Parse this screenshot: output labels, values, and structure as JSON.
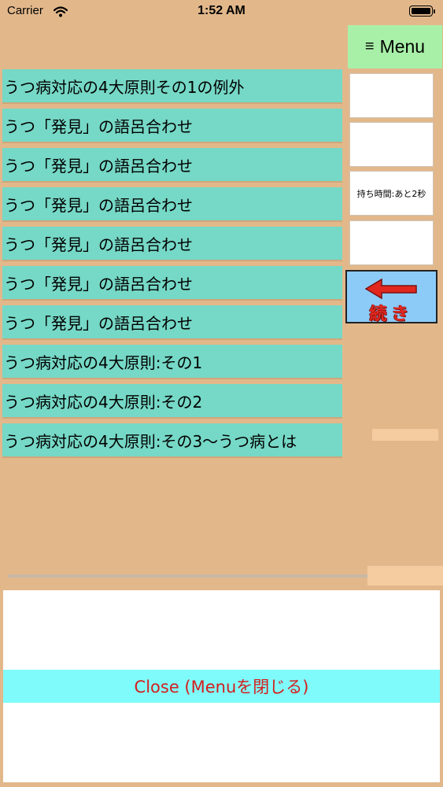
{
  "status_bar": {
    "carrier": "Carrier",
    "time": "1:52 AM",
    "icons": [
      "wifi-icon",
      "battery-icon"
    ]
  },
  "menu_button": {
    "icon": "hamburger-icon",
    "icon_glyph": "≡",
    "label": "Menu"
  },
  "list": {
    "items": [
      {
        "label": "うつ病対応の4大原則その1の例外"
      },
      {
        "label": "うつ「発見」の語呂合わせ"
      },
      {
        "label": "うつ「発見」の語呂合わせ"
      },
      {
        "label": "うつ「発見」の語呂合わせ"
      },
      {
        "label": "うつ「発見」の語呂合わせ"
      },
      {
        "label": "うつ「発見」の語呂合わせ"
      },
      {
        "label": "うつ「発見」の語呂合わせ"
      },
      {
        "label": "うつ病対応の4大原則:その1"
      },
      {
        "label": "うつ病対応の4大原則:その2"
      },
      {
        "label": "うつ病対応の4大原則:その3〜うつ病とは"
      }
    ]
  },
  "side_boxes": [
    {
      "text": ""
    },
    {
      "text": ""
    },
    {
      "text": "持ち時間:あと2秒"
    },
    {
      "text": ""
    }
  ],
  "continue_button": {
    "label": "続き",
    "icon": "left-arrow-icon"
  },
  "close_button": {
    "label": "Close (Menuを閉じる)"
  },
  "colors": {
    "background": "#E2B88B",
    "list_item": "#76D8C6",
    "menu_button": "#A8F0A8",
    "close_button": "#7FFBFB",
    "close_text": "#D41E1E",
    "continue_bg": "#8CCBF7",
    "arrow_red": "#E2281E"
  }
}
